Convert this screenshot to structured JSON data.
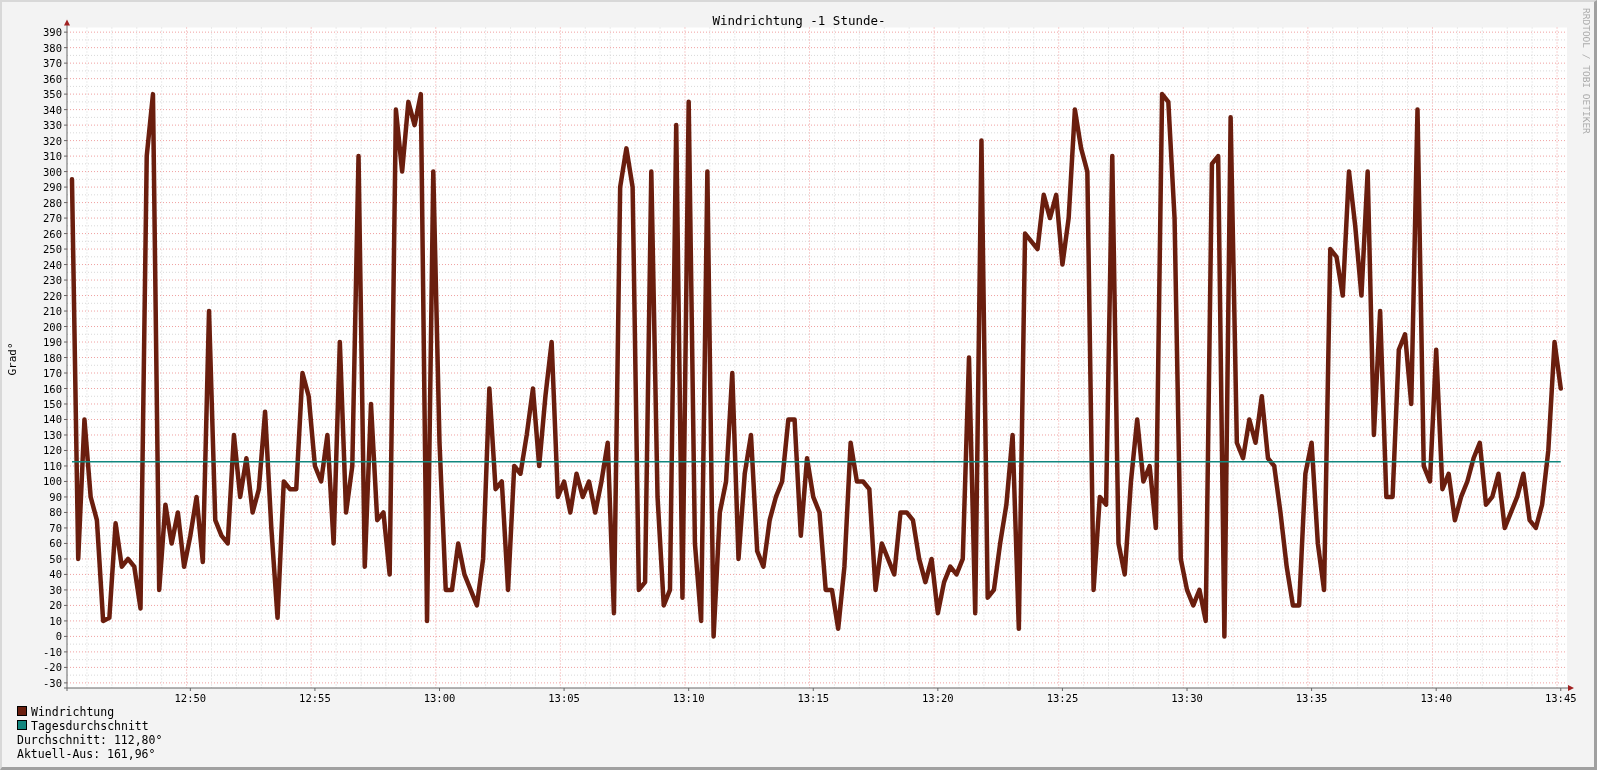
{
  "chart_data": {
    "type": "line",
    "title": "Windrichtung -1 Stunde-",
    "ylabel": "Grad°",
    "grid": true,
    "legend": true,
    "ylim": [
      -33.3,
      393
    ],
    "yticks": [
      -30,
      -20,
      -10,
      0,
      10,
      20,
      30,
      40,
      50,
      60,
      70,
      80,
      90,
      100,
      110,
      120,
      130,
      140,
      150,
      160,
      170,
      180,
      190,
      200,
      210,
      220,
      230,
      240,
      250,
      260,
      270,
      280,
      290,
      300,
      310,
      320,
      330,
      340,
      350,
      360,
      370,
      380,
      390
    ],
    "categories": [
      null,
      null,
      null,
      null,
      null,
      null,
      null,
      null,
      null,
      null,
      null,
      null,
      null,
      null,
      null,
      null,
      null,
      null,
      null,
      "12:50",
      null,
      null,
      null,
      null,
      null,
      null,
      null,
      null,
      null,
      null,
      null,
      null,
      null,
      null,
      null,
      null,
      null,
      null,
      null,
      "12:55",
      null,
      null,
      null,
      null,
      null,
      null,
      null,
      null,
      null,
      null,
      null,
      null,
      null,
      null,
      null,
      null,
      null,
      null,
      null,
      "13:00",
      null,
      null,
      null,
      null,
      null,
      null,
      null,
      null,
      null,
      null,
      null,
      null,
      null,
      null,
      null,
      null,
      null,
      null,
      null,
      "13:05",
      null,
      null,
      null,
      null,
      null,
      null,
      null,
      null,
      null,
      null,
      null,
      null,
      null,
      null,
      null,
      null,
      null,
      null,
      null,
      "13:10",
      null,
      null,
      null,
      null,
      null,
      null,
      null,
      null,
      null,
      null,
      null,
      null,
      null,
      null,
      null,
      null,
      null,
      null,
      null,
      "13:15",
      null,
      null,
      null,
      null,
      null,
      null,
      null,
      null,
      null,
      null,
      null,
      null,
      null,
      null,
      null,
      null,
      null,
      null,
      null,
      "13:20",
      null,
      null,
      null,
      null,
      null,
      null,
      null,
      null,
      null,
      null,
      null,
      null,
      null,
      null,
      null,
      null,
      null,
      null,
      null,
      "13:25",
      null,
      null,
      null,
      null,
      null,
      null,
      null,
      null,
      null,
      null,
      null,
      null,
      null,
      null,
      null,
      null,
      null,
      null,
      null,
      "13:30",
      null,
      null,
      null,
      null,
      null,
      null,
      null,
      null,
      null,
      null,
      null,
      null,
      null,
      null,
      null,
      null,
      null,
      null,
      null,
      "13:35",
      null,
      null,
      null,
      null,
      null,
      null,
      null,
      null,
      null,
      null,
      null,
      null,
      null,
      null,
      null,
      null,
      null,
      null,
      null,
      "13:40",
      null,
      null,
      null,
      null,
      null,
      null,
      null,
      null,
      null,
      null,
      null,
      null,
      null,
      null,
      null,
      null,
      null,
      null,
      null,
      "13:45"
    ],
    "series": [
      {
        "name": "Windrichtung",
        "color": "#6a1e0e",
        "values": [
          295,
          50,
          140,
          90,
          75,
          10,
          12,
          73,
          45,
          50,
          45,
          18,
          310,
          350,
          30,
          85,
          60,
          80,
          45,
          65,
          90,
          48,
          210,
          75,
          65,
          60,
          130,
          90,
          115,
          80,
          95,
          145,
          70,
          12,
          100,
          95,
          95,
          170,
          155,
          110,
          100,
          130,
          60,
          190,
          80,
          110,
          310,
          45,
          150,
          75,
          80,
          40,
          340,
          300,
          345,
          330,
          350,
          10,
          300,
          125,
          30,
          30,
          60,
          40,
          30,
          20,
          50,
          160,
          95,
          100,
          30,
          110,
          105,
          130,
          160,
          110,
          155,
          190,
          90,
          100,
          80,
          105,
          90,
          100,
          80,
          100,
          125,
          15,
          290,
          315,
          290,
          30,
          35,
          300,
          90,
          20,
          30,
          330,
          25,
          345,
          60,
          10,
          300,
          0,
          80,
          100,
          170,
          50,
          105,
          130,
          55,
          45,
          75,
          90,
          100,
          140,
          140,
          65,
          115,
          90,
          80,
          30,
          30,
          5,
          45,
          125,
          100,
          100,
          95,
          30,
          60,
          50,
          40,
          80,
          80,
          75,
          50,
          35,
          50,
          15,
          35,
          45,
          40,
          50,
          180,
          15,
          320,
          25,
          30,
          60,
          85,
          130,
          5,
          260,
          255,
          250,
          285,
          270,
          285,
          240,
          270,
          340,
          315,
          300,
          30,
          90,
          85,
          310,
          60,
          40,
          100,
          140,
          100,
          110,
          70,
          350,
          345,
          270,
          50,
          30,
          20,
          30,
          10,
          305,
          310,
          0,
          335,
          125,
          115,
          140,
          125,
          155,
          115,
          110,
          80,
          45,
          20,
          20,
          105,
          125,
          60,
          30,
          250,
          245,
          220,
          300,
          265,
          220,
          300,
          130,
          210,
          90,
          90,
          185,
          195,
          150,
          340,
          110,
          100,
          185,
          95,
          105,
          75,
          90,
          100,
          115,
          125,
          85,
          90,
          105,
          70,
          80,
          90,
          105,
          75,
          70,
          85,
          120,
          190,
          160
        ]
      },
      {
        "name": "Tagesdurchschnitt",
        "color": "#13877f",
        "values": [
          112.8,
          112.8,
          112.8,
          112.8,
          112.8,
          112.8,
          112.8,
          112.8,
          112.8,
          112.8,
          112.8,
          112.8,
          112.8,
          112.8,
          112.8,
          112.8,
          112.8,
          112.8,
          112.8,
          112.8,
          112.8,
          112.8,
          112.8,
          112.8,
          112.8,
          112.8,
          112.8,
          112.8,
          112.8,
          112.8,
          112.8,
          112.8,
          112.8,
          112.8,
          112.8,
          112.8,
          112.8,
          112.8,
          112.8,
          112.8,
          112.8,
          112.8,
          112.8,
          112.8,
          112.8,
          112.8,
          112.8,
          112.8,
          112.8,
          112.8,
          112.8,
          112.8,
          112.8,
          112.8,
          112.8,
          112.8,
          112.8,
          112.8,
          112.8,
          112.8,
          112.8,
          112.8,
          112.8,
          112.8,
          112.8,
          112.8,
          112.8,
          112.8,
          112.8,
          112.8,
          112.8,
          112.8,
          112.8,
          112.8,
          112.8,
          112.8,
          112.8,
          112.8,
          112.8,
          112.8,
          112.8,
          112.8,
          112.8,
          112.8,
          112.8,
          112.8,
          112.8,
          112.8,
          112.8,
          112.8,
          112.8,
          112.8,
          112.8,
          112.8,
          112.8,
          112.8,
          112.8,
          112.8,
          112.8,
          112.8,
          112.8,
          112.8,
          112.8,
          112.8,
          112.8,
          112.8,
          112.8,
          112.8,
          112.8,
          112.8,
          112.8,
          112.8,
          112.8,
          112.8,
          112.8,
          112.8,
          112.8,
          112.8,
          112.8,
          112.8,
          112.8,
          112.8,
          112.8,
          112.8,
          112.8,
          112.8,
          112.8,
          112.8,
          112.8,
          112.8,
          112.8,
          112.8,
          112.8,
          112.8,
          112.8,
          112.8,
          112.8,
          112.8,
          112.8,
          112.8,
          112.8,
          112.8,
          112.8,
          112.8,
          112.8,
          112.8,
          112.8,
          112.8,
          112.8,
          112.8,
          112.8,
          112.8,
          112.8,
          112.8,
          112.8,
          112.8,
          112.8,
          112.8,
          112.8,
          112.8,
          112.8,
          112.8,
          112.8,
          112.8,
          112.8,
          112.8,
          112.8,
          112.8,
          112.8,
          112.8,
          112.8,
          112.8,
          112.8,
          112.8,
          112.8,
          112.8,
          112.8,
          112.8,
          112.8,
          112.8,
          112.8,
          112.8,
          112.8,
          112.8,
          112.8,
          112.8,
          112.8,
          112.8,
          112.8,
          112.8,
          112.8,
          112.8,
          112.8,
          112.8,
          112.8,
          112.8,
          112.8,
          112.8,
          112.8,
          112.8,
          112.8,
          112.8,
          112.8,
          112.8,
          112.8,
          112.8,
          112.8,
          112.8,
          112.8,
          112.8,
          112.8,
          112.8,
          112.8,
          112.8,
          112.8,
          112.8,
          112.8,
          112.8,
          112.8,
          112.8,
          112.8,
          112.8,
          112.8,
          112.8,
          112.8,
          112.8,
          112.8,
          112.8,
          112.8,
          112.8,
          112.8,
          112.8,
          112.8,
          112.8,
          112.8,
          112.8,
          112.8,
          112.8,
          112.8,
          112.8
        ]
      }
    ]
  },
  "legend_notes": [
    "Durchschnitt: 112,80°",
    "Aktuell-Aus: 161,96°"
  ],
  "credit": "RRDTOOL / TOBI OETIKER"
}
